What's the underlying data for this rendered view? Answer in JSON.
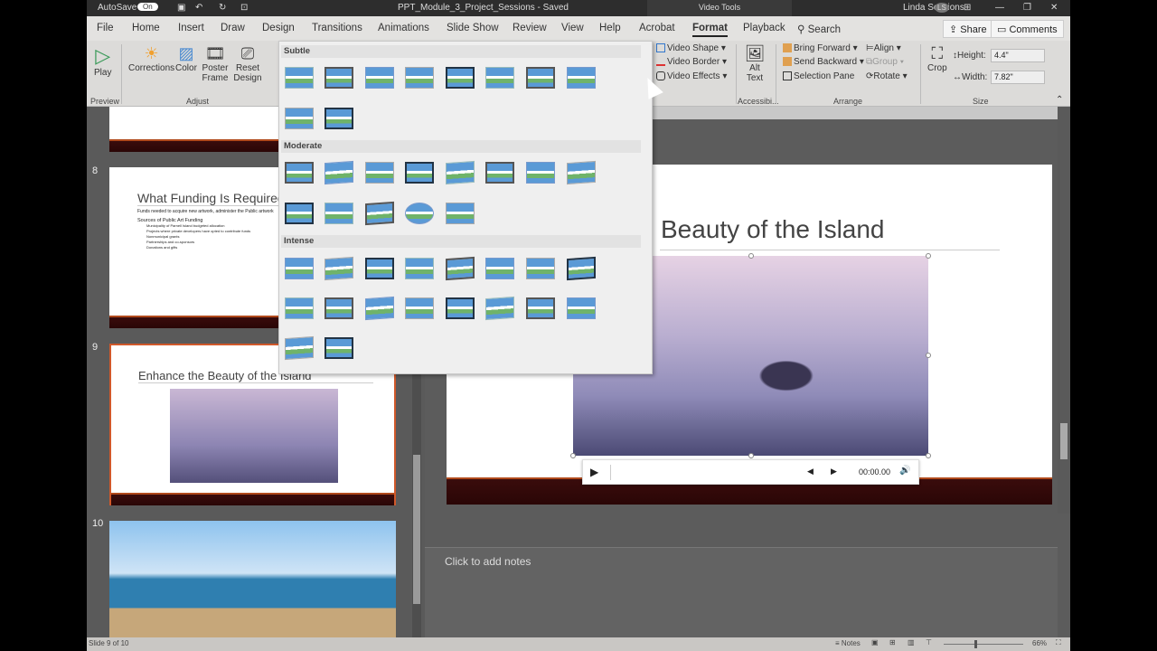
{
  "titlebar": {
    "autosave": "AutoSave",
    "autosave_state": "On",
    "doc_title": "PPT_Module_3_Project_Sessions  -  Saved",
    "context_tab": "Video Tools",
    "user": "Linda Sessions",
    "initials": "LS"
  },
  "tabs": [
    "File",
    "Home",
    "Insert",
    "Draw",
    "Design",
    "Transitions",
    "Animations",
    "Slide Show",
    "Review",
    "View",
    "Help",
    "Acrobat",
    "Format",
    "Playback"
  ],
  "search": "Search",
  "share": "Share",
  "comments": "Comments",
  "ribbon": {
    "play": "Play",
    "preview": "Preview",
    "corrections": "Corrections",
    "color": "Color",
    "poster": "Poster Frame",
    "reset": "Reset Design",
    "adjust": "Adjust",
    "video_shape": "Video Shape",
    "video_border": "Video Border",
    "video_effects": "Video Effects",
    "alt_text": "Alt Text",
    "accessibility": "Accessibi...",
    "bring_forward": "Bring Forward",
    "send_backward": "Send Backward",
    "selection_pane": "Selection Pane",
    "align": "Align",
    "group": "Group",
    "rotate": "Rotate",
    "arrange": "Arrange",
    "crop": "Crop",
    "height_label": "Height:",
    "height": "4.4\"",
    "width_label": "Width:",
    "width": "7.82\"",
    "size": "Size"
  },
  "gallery": {
    "sections": [
      {
        "name": "Subtle",
        "count": 10
      },
      {
        "name": "Moderate",
        "count": 13
      },
      {
        "name": "Intense",
        "count": 18
      }
    ]
  },
  "slides": [
    {
      "num": "8",
      "title": "What Funding Is Required",
      "body": "Funds needed to acquire new artwork, administer the Public artwork",
      "sub": "Sources of Public Art Funding",
      "bullets": [
        "Municipality of Parnell Island budgeted allocation",
        "Projects where private developers have opted to contribute funds",
        "Nonmunicipal grants",
        "Partnerships and co-sponsors",
        "Donations and gifts"
      ]
    },
    {
      "num": "9",
      "title": "Enhance the Beauty of the Island"
    },
    {
      "num": "10"
    }
  ],
  "slide": {
    "title": "Beauty of the Island",
    "time": "00:00.00"
  },
  "notes": "Click to add notes",
  "status": {
    "slide": "Slide 9 of 10",
    "notes": "Notes",
    "zoom": "66%"
  }
}
